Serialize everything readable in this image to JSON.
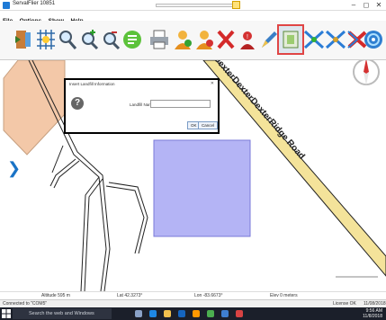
{
  "window": {
    "title": "ServalFlier 10851",
    "min_label": "–",
    "max_label": "◻",
    "close_label": "✕"
  },
  "menu": [
    "File",
    "Options",
    "Show",
    "Help"
  ],
  "toolbar": {
    "tools": [
      {
        "name": "exit-icon"
      },
      {
        "name": "pan-grid-icon"
      },
      {
        "name": "zoom-icon"
      },
      {
        "name": "zoom-in-icon"
      },
      {
        "name": "zoom-out-icon"
      },
      {
        "name": "landmark-icon"
      },
      {
        "name": "print-icon"
      },
      {
        "name": "person-add-icon"
      },
      {
        "name": "person-remove-icon"
      },
      {
        "name": "delete-icon"
      },
      {
        "name": "alert-icon"
      },
      {
        "name": "edit-icon"
      },
      {
        "name": "select-area-icon"
      },
      {
        "name": "route-icon"
      },
      {
        "name": "route-alt-icon"
      },
      {
        "name": "clear-route-icon"
      },
      {
        "name": "globe-icon"
      }
    ],
    "active": "select-area-icon"
  },
  "map": {
    "road_label": "DexterDexterDexterRidge Road"
  },
  "status": {
    "altitude": "Altitude  595 m",
    "lat": "Lat 42.3273°",
    "lon": "Lon -83.6673°",
    "elev": "Elev   0 meters"
  },
  "connection": {
    "text": "Connected to \"COM5\"",
    "license": "License OK",
    "date_right": "11/08/2018"
  },
  "taskbar": {
    "search_placeholder": "Search the web and Windows",
    "time": "9:56 AM",
    "date": "11/8/2018"
  },
  "dialog": {
    "title": "Insert Landfill Information",
    "close": "✕",
    "field_label": "Landfill Name",
    "field_value": "",
    "ok_label": "OK",
    "cancel_label": "Cancel"
  },
  "colors": {
    "accent": "#1a73c6",
    "parcel_fill": "#f3c8a8",
    "landfill_fill": "#b4b4f5",
    "road_fill": "#f4e39a"
  }
}
